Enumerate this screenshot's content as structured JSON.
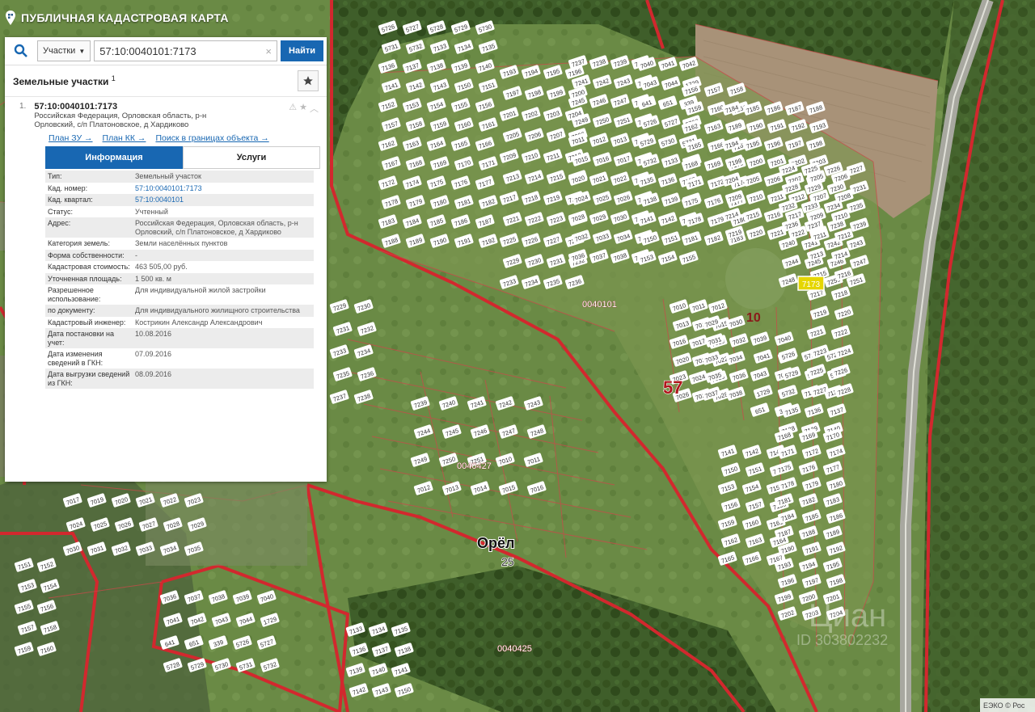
{
  "header": {
    "title": "ПУБЛИЧНАЯ КАДАСТРОВАЯ КАРТА"
  },
  "search": {
    "type_label": "Участки",
    "query": "57:10:0040101:7173",
    "find_label": "Найти"
  },
  "section": {
    "title": "Земельные участки",
    "count": "1"
  },
  "result": {
    "index": "1.",
    "cadastral_number": "57:10:0040101:7173",
    "address_line1": "Российская Федерация, Орловская область, р-н",
    "address_line2": "Орловский, с/п Платоновское, д Хардиково",
    "links": [
      "План ЗУ →",
      "План КК →",
      "Поиск в границах объекта →"
    ]
  },
  "tabs": {
    "info": "Информация",
    "services": "Услуги"
  },
  "info_rows": [
    {
      "k": "Тип:",
      "v": "Земельный участок"
    },
    {
      "k": "Кад. номер:",
      "v": "57:10:0040101:7173",
      "link": true
    },
    {
      "k": "Кад. квартал:",
      "v": "57:10:0040101",
      "link": true
    },
    {
      "k": "Статус:",
      "v": "Учтенный"
    },
    {
      "k": "Адрес:",
      "v": "Российская Федерация, Орловская область, р-н Орловский, с/п Платоновское, д Хардиково"
    },
    {
      "k": "Категория земель:",
      "v": "Земли населённых пунктов"
    },
    {
      "k": "Форма собственности:",
      "v": "-"
    },
    {
      "k": "Кадастровая стоимость:",
      "v": "463 505,00 руб."
    },
    {
      "k": "Уточненная площадь:",
      "v": "1 500 кв. м"
    },
    {
      "k": "Разрешенное использование:",
      "v": "Для индивидуальной жилой застройки"
    },
    {
      "k": "по документу:",
      "v": "Для индивидуального жилищного строительства"
    },
    {
      "k": "Кадастровый инженер:",
      "v": "Кострикин Александр Александрович"
    },
    {
      "k": "Дата постановки на учет:",
      "v": "10.08.2016"
    },
    {
      "k": "Дата изменения сведений в ГКН:",
      "v": "07.09.2016"
    },
    {
      "k": "Дата выгрузки сведений из ГКН:",
      "v": "08.09.2016"
    }
  ],
  "map_labels": {
    "city": "Орёл",
    "city_num": "25",
    "zone_57": "57",
    "zone_10": "10",
    "quarter_0040101": "0040101",
    "quarter_0040427": "0040427",
    "quarter_0040425": "0040425",
    "highlighted": "7173",
    "watermark": "Циан",
    "watermark_id": "ID 303802232",
    "attribution": "ЕЭКО © Рос"
  },
  "parcel_numbers": [
    "5726",
    "5727",
    "5728",
    "5729",
    "5730",
    "5731",
    "5732",
    "7133",
    "7134",
    "7135",
    "7136",
    "7137",
    "7138",
    "7139",
    "7140",
    "7141",
    "7142",
    "7143",
    "7150",
    "7151",
    "7152",
    "7153",
    "7154",
    "7155",
    "7156",
    "7157",
    "7158",
    "7159",
    "7160",
    "7161",
    "7162",
    "7163",
    "7164",
    "7165",
    "7166",
    "7167",
    "7168",
    "7169",
    "7170",
    "7171",
    "7172",
    "7174",
    "7175",
    "7176",
    "7177",
    "7178",
    "7179",
    "7180",
    "7181",
    "7182",
    "7183",
    "7184",
    "7185",
    "7186",
    "7187",
    "7188",
    "7189",
    "7190",
    "7191",
    "7192",
    "7193",
    "7194",
    "7195",
    "7196",
    "7197",
    "7198",
    "7199",
    "7200",
    "7201",
    "7202",
    "7203",
    "7204",
    "7205",
    "7206",
    "7207",
    "7208",
    "7209",
    "7210",
    "7211",
    "7212",
    "7213",
    "7214",
    "7215",
    "7216",
    "7217",
    "7218",
    "7219",
    "7220",
    "7221",
    "7222",
    "7223",
    "7224",
    "7225",
    "7226",
    "7227",
    "7228",
    "7229",
    "7230",
    "7231",
    "7232",
    "7233",
    "7234",
    "7235",
    "7236",
    "7237",
    "7238",
    "7239",
    "7240",
    "7241",
    "7242",
    "7243",
    "7244",
    "7245",
    "7246",
    "7247",
    "7248",
    "7249",
    "7250",
    "7251",
    "7010",
    "7011",
    "7012",
    "7013",
    "7014",
    "7015",
    "7016",
    "7017",
    "7019",
    "7020",
    "7021",
    "7022",
    "7023",
    "7024",
    "7025",
    "7026",
    "7027",
    "7028",
    "7029",
    "7030",
    "7031",
    "7032",
    "7033",
    "7034",
    "7035",
    "7036",
    "7037",
    "7038",
    "7039",
    "7040",
    "7041",
    "7042",
    "7043",
    "7044",
    "1729",
    "641",
    "651",
    "339"
  ]
}
